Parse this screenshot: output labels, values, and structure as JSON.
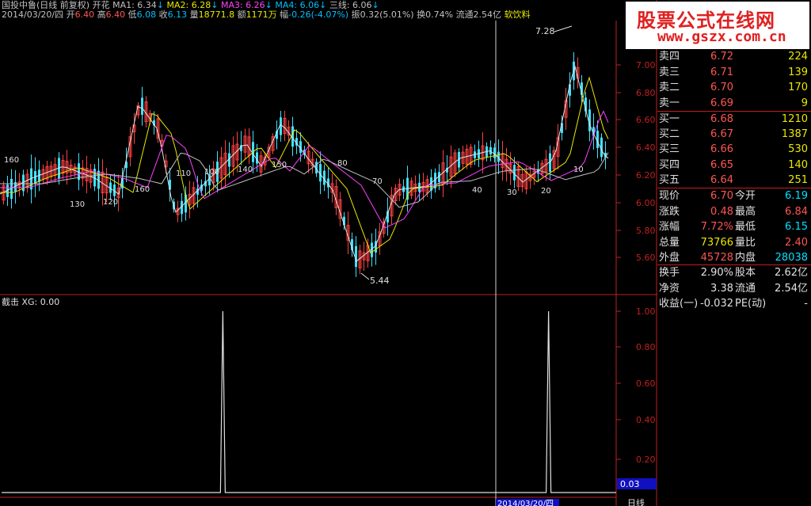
{
  "header": {
    "title": "国投中鲁(日线 前复权) 开花",
    "ma1_label": "MA1: 6.34",
    "ma2_label": "MA2: 6.28",
    "ma3_label": "MA3: 6.26",
    "ma4_label": "MA4: 6.06",
    "sanxian_label": "三线: 6.06",
    "arrow": "↓"
  },
  "quote_line": {
    "date": "2014/03/20/四",
    "open_label": "开",
    "open": "6.40",
    "high_label": "高",
    "high": "6.40",
    "low_label": "低",
    "low": "6.08",
    "close_label": "收",
    "close": "6.13",
    "vol_label": "量",
    "vol": "18771.8",
    "amount_label": "额",
    "amount": "1171万",
    "range_label": "幅",
    "range": "-0.26(-4.07%)",
    "swing": "振0.32(5.01%)",
    "turnover": "换0.74%",
    "float": "流通2.54亿",
    "industry": "软饮料"
  },
  "price_axis": [
    "7.00",
    "6.80",
    "6.60",
    "6.40",
    "6.20",
    "6.00",
    "5.80",
    "5.60"
  ],
  "indicator": {
    "title": "截击",
    "xg": "XG: 0.00",
    "axis": [
      "1.00",
      "0.80",
      "0.60",
      "0.40",
      "0.20"
    ],
    "current_value": "0.03",
    "signals": [
      {
        "position": 0.36,
        "value": 1.0
      },
      {
        "position": 0.89,
        "value": 1.0
      }
    ]
  },
  "chart_annotations": {
    "high_marker": "7.28",
    "low_marker": "5.44",
    "ma_labels": [
      "160",
      "130",
      "120",
      "110",
      "100",
      "140",
      "150",
      "160",
      "80",
      "70",
      "40",
      "30",
      "20",
      "10"
    ]
  },
  "bottom_bar": {
    "date_label": "2014/03/20/四",
    "period": "日线"
  },
  "banner": {
    "title": "股票公式在线网",
    "url": "www.gszx.com.cn"
  },
  "orderbook": {
    "asks": [
      {
        "label": "卖四",
        "price": "6.72",
        "vol": "224"
      },
      {
        "label": "卖三",
        "price": "6.71",
        "vol": "139"
      },
      {
        "label": "卖二",
        "price": "6.70",
        "vol": "170"
      },
      {
        "label": "卖一",
        "price": "6.69",
        "vol": "9"
      }
    ],
    "bids": [
      {
        "label": "买一",
        "price": "6.68",
        "vol": "1210"
      },
      {
        "label": "买二",
        "price": "6.67",
        "vol": "1387"
      },
      {
        "label": "买三",
        "price": "6.66",
        "vol": "530"
      },
      {
        "label": "买四",
        "price": "6.65",
        "vol": "140"
      },
      {
        "label": "买五",
        "price": "6.64",
        "vol": "251"
      }
    ]
  },
  "stats": {
    "xianjia_label": "现价",
    "xianjia": "6.70",
    "jinkai_label": "今开",
    "jinkai": "6.19",
    "zhangdie_label": "涨跌",
    "zhangdie": "0.48",
    "zuigao_label": "最高",
    "zuigao": "6.84",
    "zhangfu_label": "涨幅",
    "zhangfu": "7.72%",
    "zuidi_label": "最低",
    "zuidi": "6.15",
    "zongliang_label": "总量",
    "zongliang": "73766",
    "liangbi_label": "量比",
    "liangbi": "2.40",
    "waipan_label": "外盘",
    "waipan": "45728",
    "neipan_label": "内盘",
    "neipan": "28038",
    "huanshou_label": "换手",
    "huanshou": "2.90%",
    "guben_label": "股本",
    "guben": "2.62亿",
    "jingzi_label": "净资",
    "jingzi": "3.38",
    "liutong_label": "流通",
    "liutong": "2.54亿",
    "shouyi_label": "收益(一)",
    "shouyi": "-0.032",
    "pe_label": "PE(动)",
    "pe": "-"
  },
  "colors": {
    "up": "#ff5555",
    "down": "#00e0ff",
    "ma1": "#e0e0e0",
    "ma2": "#e8e800",
    "ma3": "#ff40ff",
    "ma4": "#c0c0c0",
    "axis": "#c02020"
  }
}
